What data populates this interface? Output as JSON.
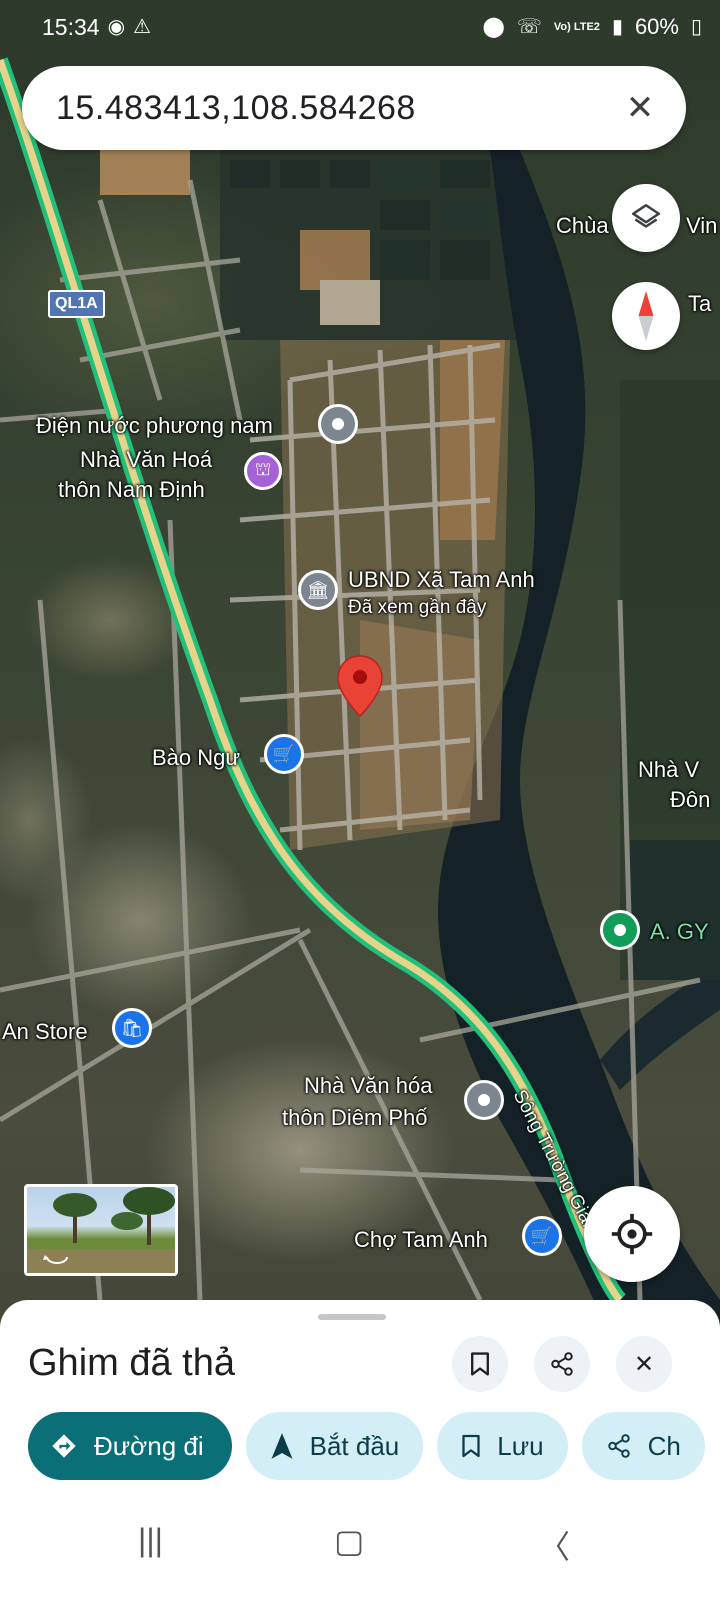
{
  "status_bar": {
    "time": "15:34",
    "battery": "60%",
    "network": "Vo) LTE2",
    "left_icons": [
      "messenger-icon",
      "warning-icon"
    ],
    "right_icons": [
      "location-icon",
      "wifi-call-icon",
      "signal-icon",
      "battery-icon"
    ]
  },
  "search": {
    "query": "15.483413,108.584268",
    "clear_icon": "close-icon"
  },
  "map": {
    "highway_shield": "QL1A",
    "labels": {
      "chua": "Chùa",
      "vin": "Vin",
      "ta": "Ta",
      "dien_nuoc": "Điện nước phương nam",
      "nha_van_hoa_nd_line1": "Nhà Văn Hoá",
      "nha_van_hoa_nd_line2": "thôn Nam Định",
      "ubnd": "UBND Xã Tam Anh",
      "ubnd_sub": "Đã xem gần đây",
      "bao_ngu": "Bào Ngư",
      "nha_v": "Nhà V",
      "don": "Đôn",
      "a_gy": "A. GY",
      "an_store": "An Store",
      "song": "Sông Trường Giang",
      "nha_van_hoa_dp_line1": "Nhà Văn hóa",
      "nha_van_hoa_dp_line2": "thôn Diêm Phố",
      "cho_tam_anh": "Chợ Tam Anh"
    },
    "dropped_pin_color": "#ea4335"
  },
  "sheet": {
    "title": "Ghim đã thả",
    "actions": {
      "directions": "Đường đi",
      "start": "Bắt đầu",
      "save": "Lưu",
      "share": "Ch"
    }
  },
  "colors": {
    "accent_teal": "#0b6f78",
    "chip_bg": "#d3eef5",
    "road_green": "#22c07a",
    "road_yellow": "#e8d38b"
  }
}
